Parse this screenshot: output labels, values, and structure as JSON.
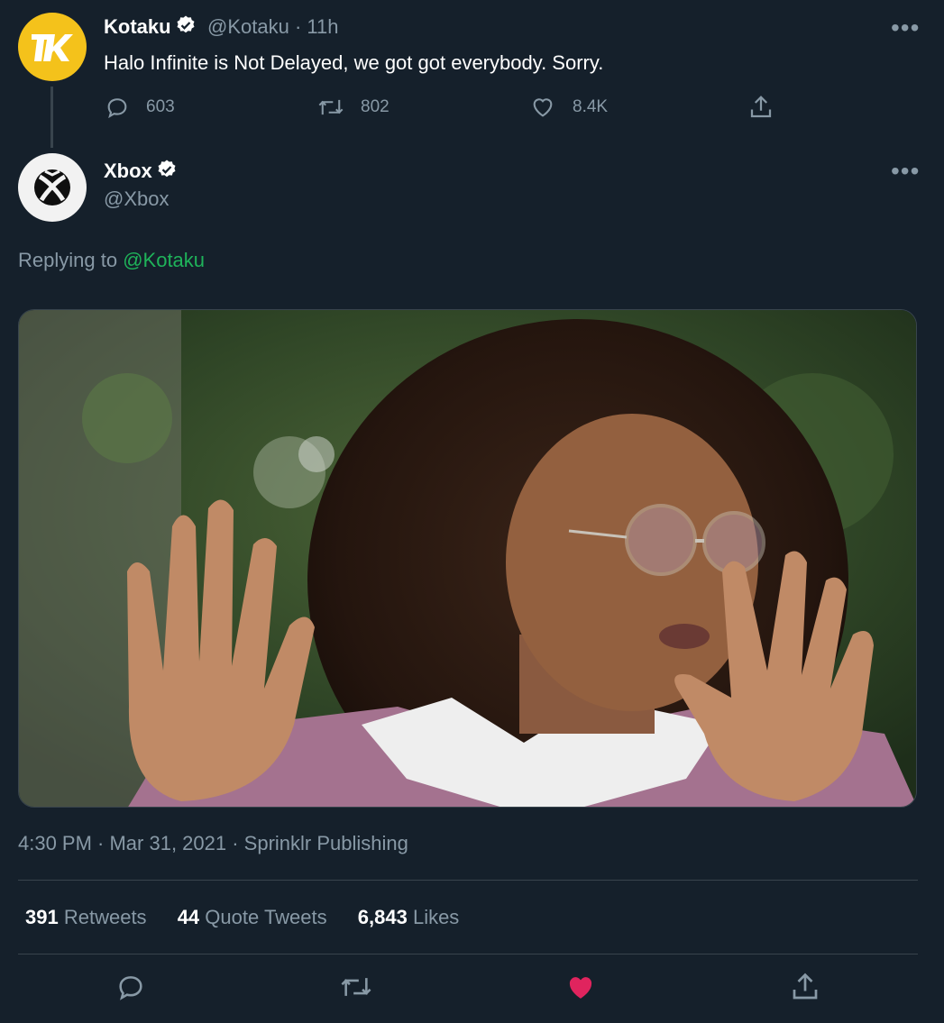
{
  "colors": {
    "background": "#15202b",
    "muted": "#8899a6",
    "mention": "#1fb35a",
    "like_active": "#e0245e",
    "kotaku_brand": "#f4c21b"
  },
  "parent_tweet": {
    "author_name": "Kotaku",
    "handle_time": "@Kotaku · 11h",
    "avatar_icon": "kotaku-logo-icon",
    "text": "Halo Infinite is Not Delayed, we got got everybody. Sorry.",
    "replies": "603",
    "retweets": "802",
    "likes": "8.4K"
  },
  "main_tweet": {
    "author_name": "Xbox",
    "handle": "@Xbox",
    "avatar_icon": "xbox-logo-icon",
    "replying_prefix": "Replying to",
    "replying_to": "@Kotaku",
    "timestamp": "4:30 PM · Mar 31, 2021 · Sprinklr Publishing",
    "stats": {
      "retweets_count": "391",
      "retweets_label": "Retweets",
      "quotes_count": "44",
      "quotes_label": "Quote Tweets",
      "likes_count": "6,843",
      "likes_label": "Likes"
    }
  }
}
